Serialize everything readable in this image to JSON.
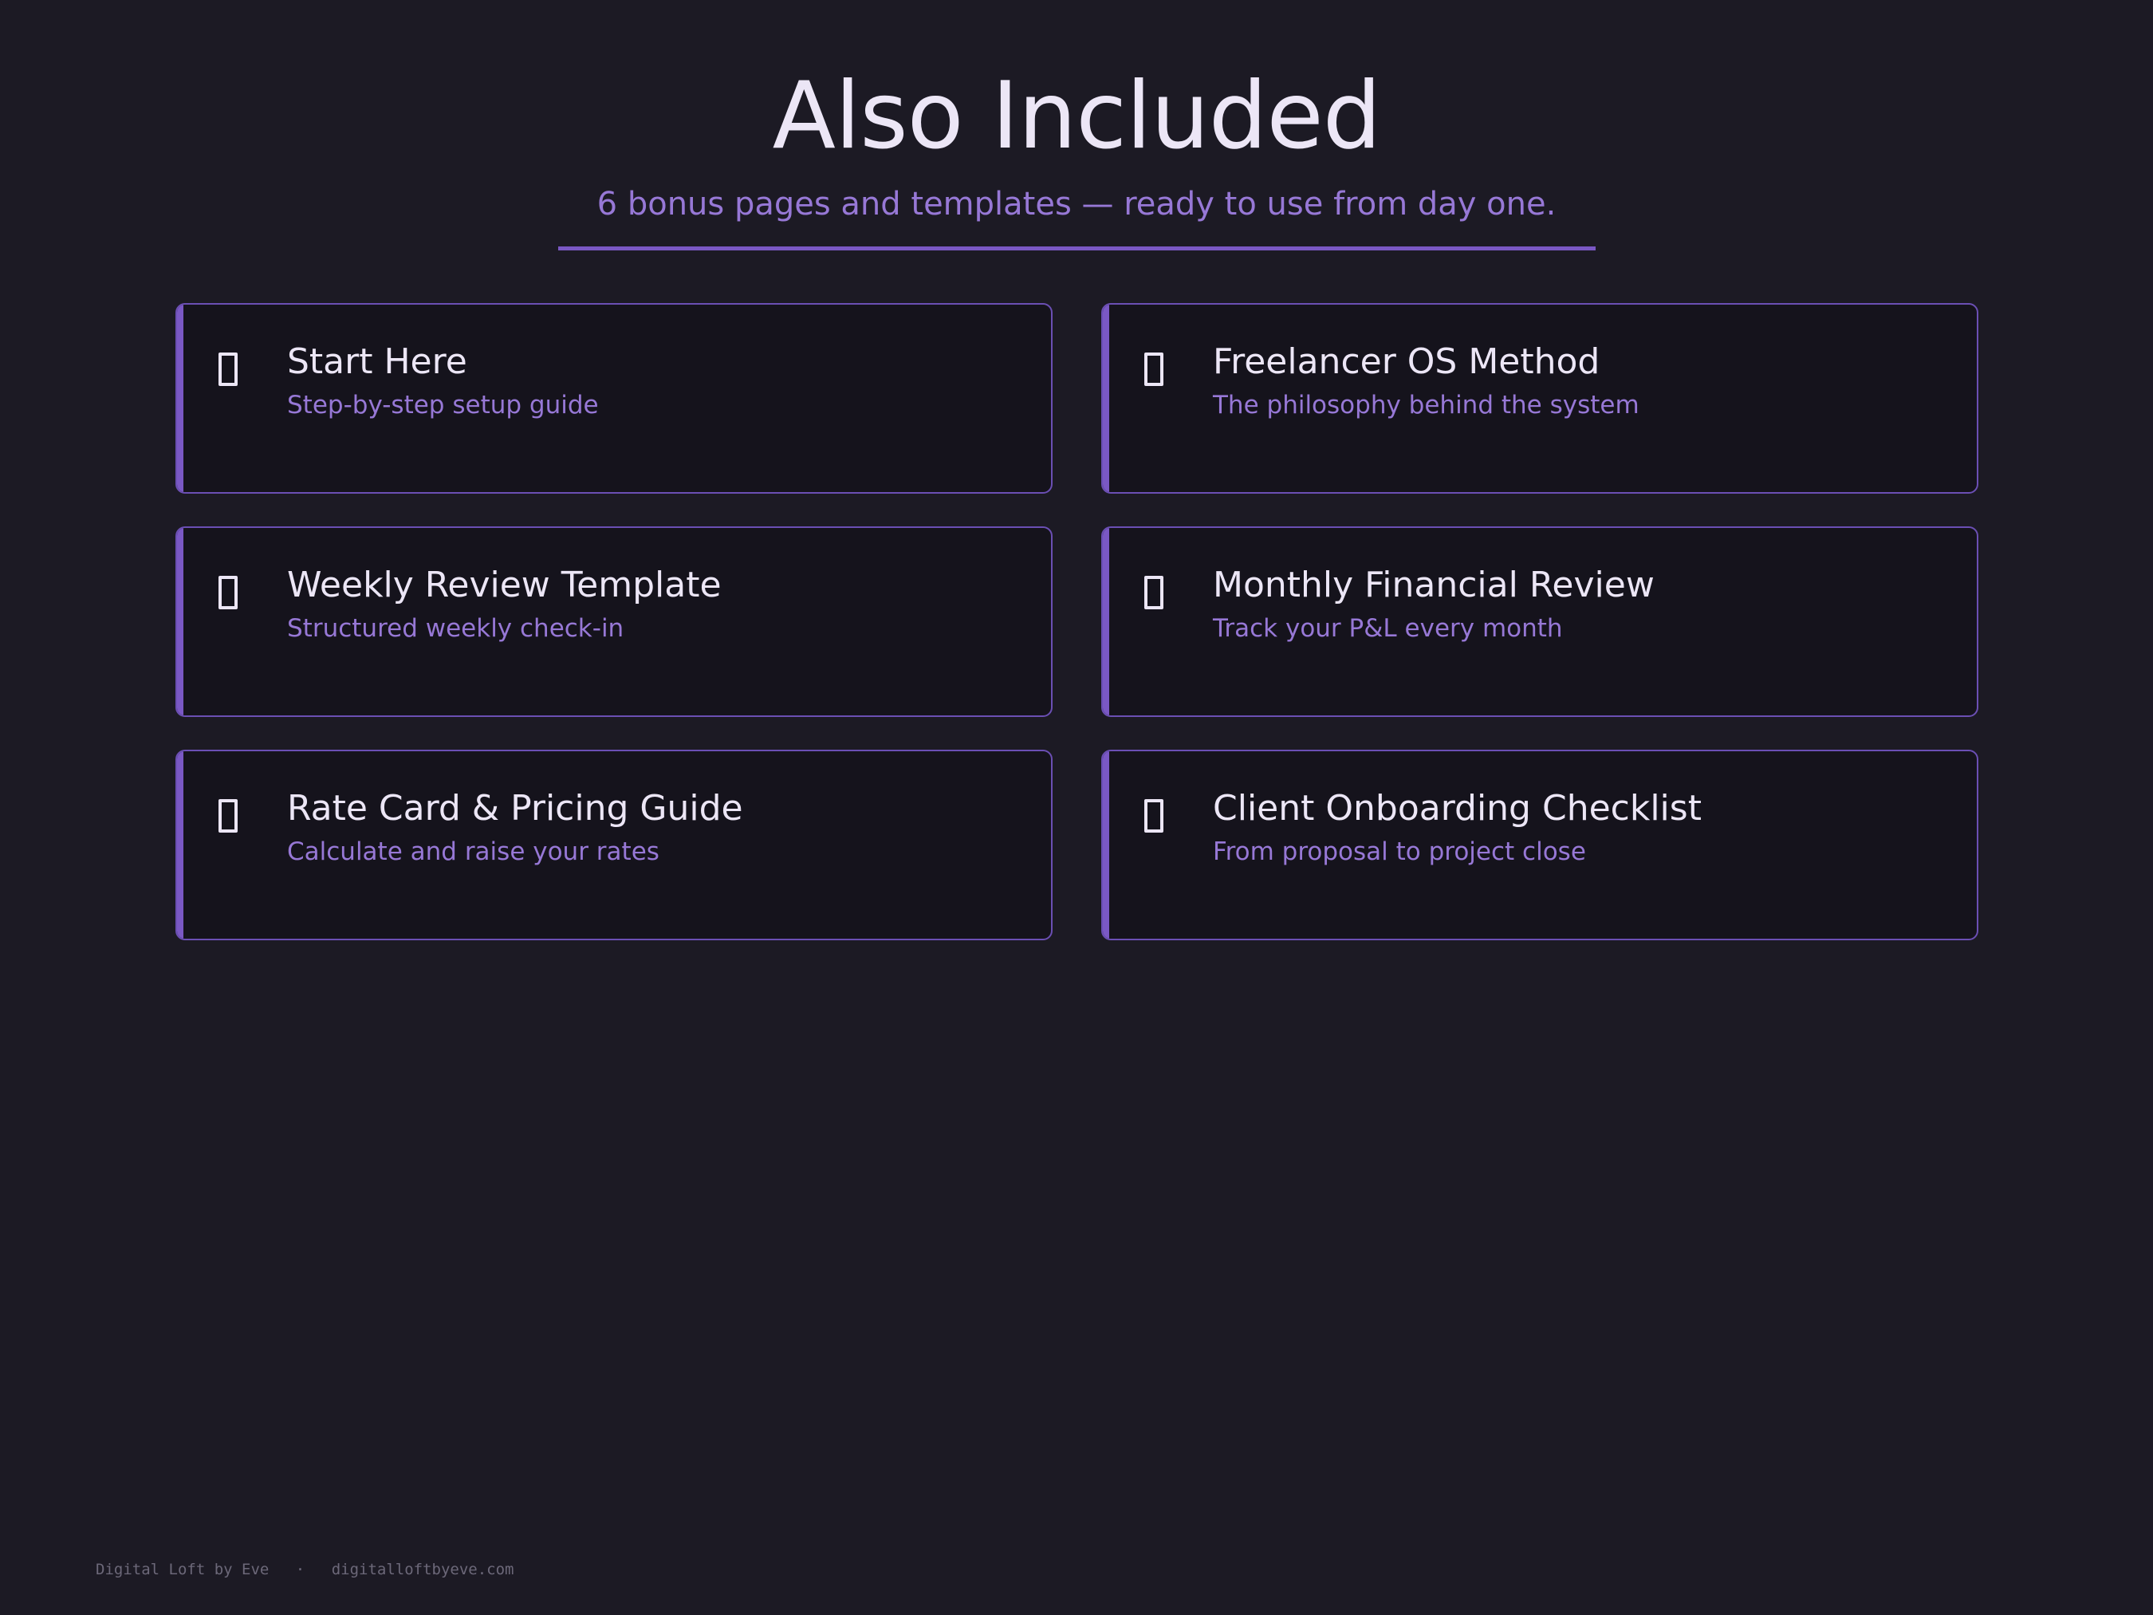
{
  "header": {
    "title": "Also Included",
    "subtitle": "6 bonus pages and templates — ready to use from day one."
  },
  "cards": [
    {
      "title": "Start Here",
      "description": "Step-by-step setup guide",
      "icon": "page-icon"
    },
    {
      "title": "Freelancer OS Method",
      "description": "The philosophy behind the system",
      "icon": "page-icon"
    },
    {
      "title": "Weekly Review Template",
      "description": "Structured weekly check-in",
      "icon": "page-icon"
    },
    {
      "title": "Monthly Financial Review",
      "description": "Track your P&L every month",
      "icon": "page-icon"
    },
    {
      "title": "Rate Card & Pricing Guide",
      "description": "Calculate and raise your rates",
      "icon": "page-icon"
    },
    {
      "title": "Client Onboarding Checklist",
      "description": "From proposal to project close",
      "icon": "page-icon"
    }
  ],
  "footer": {
    "brand": "Digital Loft by Eve",
    "separator": "·",
    "url": "digitalloftbyeve.com"
  },
  "colors": {
    "background": "#1c1a24",
    "card_background": "#15131c",
    "accent": "#7a58c4",
    "subtitle": "#9778d6",
    "text": "#ece6f6"
  }
}
